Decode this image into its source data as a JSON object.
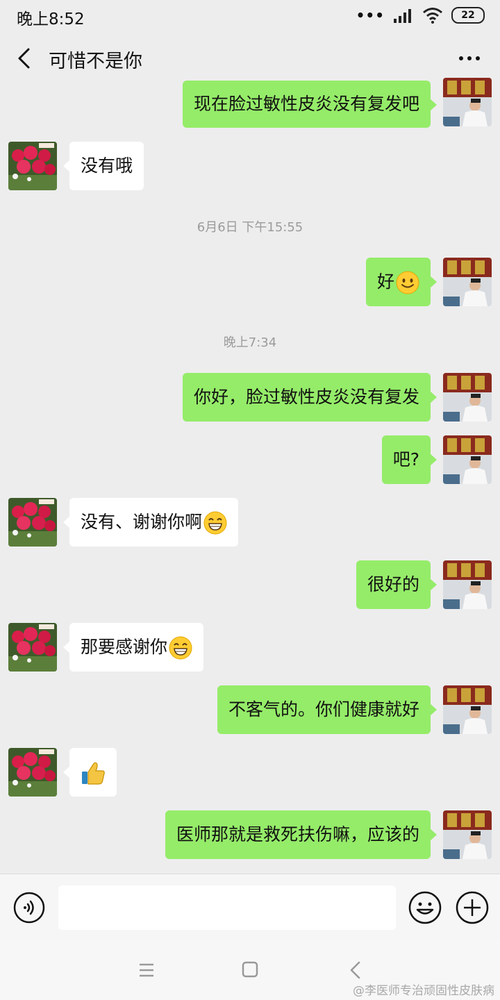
{
  "status_bar": {
    "time": "晚上8:52",
    "battery": "22"
  },
  "header": {
    "title": "可惜不是你"
  },
  "chat": {
    "messages": [
      {
        "side": "right",
        "text": "现在脸过敏性皮炎没有复发吧"
      },
      {
        "side": "left",
        "text": "没有哦"
      },
      {
        "side": "right",
        "text": "好",
        "emoji": "smile"
      },
      {
        "side": "right",
        "text": "你好，脸过敏性皮炎没有复发"
      },
      {
        "side": "right",
        "text": "吧?"
      },
      {
        "side": "left",
        "text": "没有、谢谢你啊",
        "emoji": "grin"
      },
      {
        "side": "right",
        "text": "很好的"
      },
      {
        "side": "left",
        "text": "那要感谢你",
        "emoji": "grin"
      },
      {
        "side": "right",
        "text": "不客气的。你们健康就好"
      },
      {
        "side": "left",
        "text": "",
        "emoji": "thumbs-up"
      },
      {
        "side": "right",
        "text": "医师那就是救死扶伤嘛，应该的"
      }
    ],
    "timestamps": [
      "6月6日 下午15:55",
      "晚上7:34"
    ]
  },
  "input_bar": {
    "text": ""
  },
  "watermark": "@李医师专治顽固性皮肤病",
  "colors": {
    "background": "#ededed",
    "sent_bubble": "#95ec69",
    "received_bubble": "#ffffff"
  }
}
